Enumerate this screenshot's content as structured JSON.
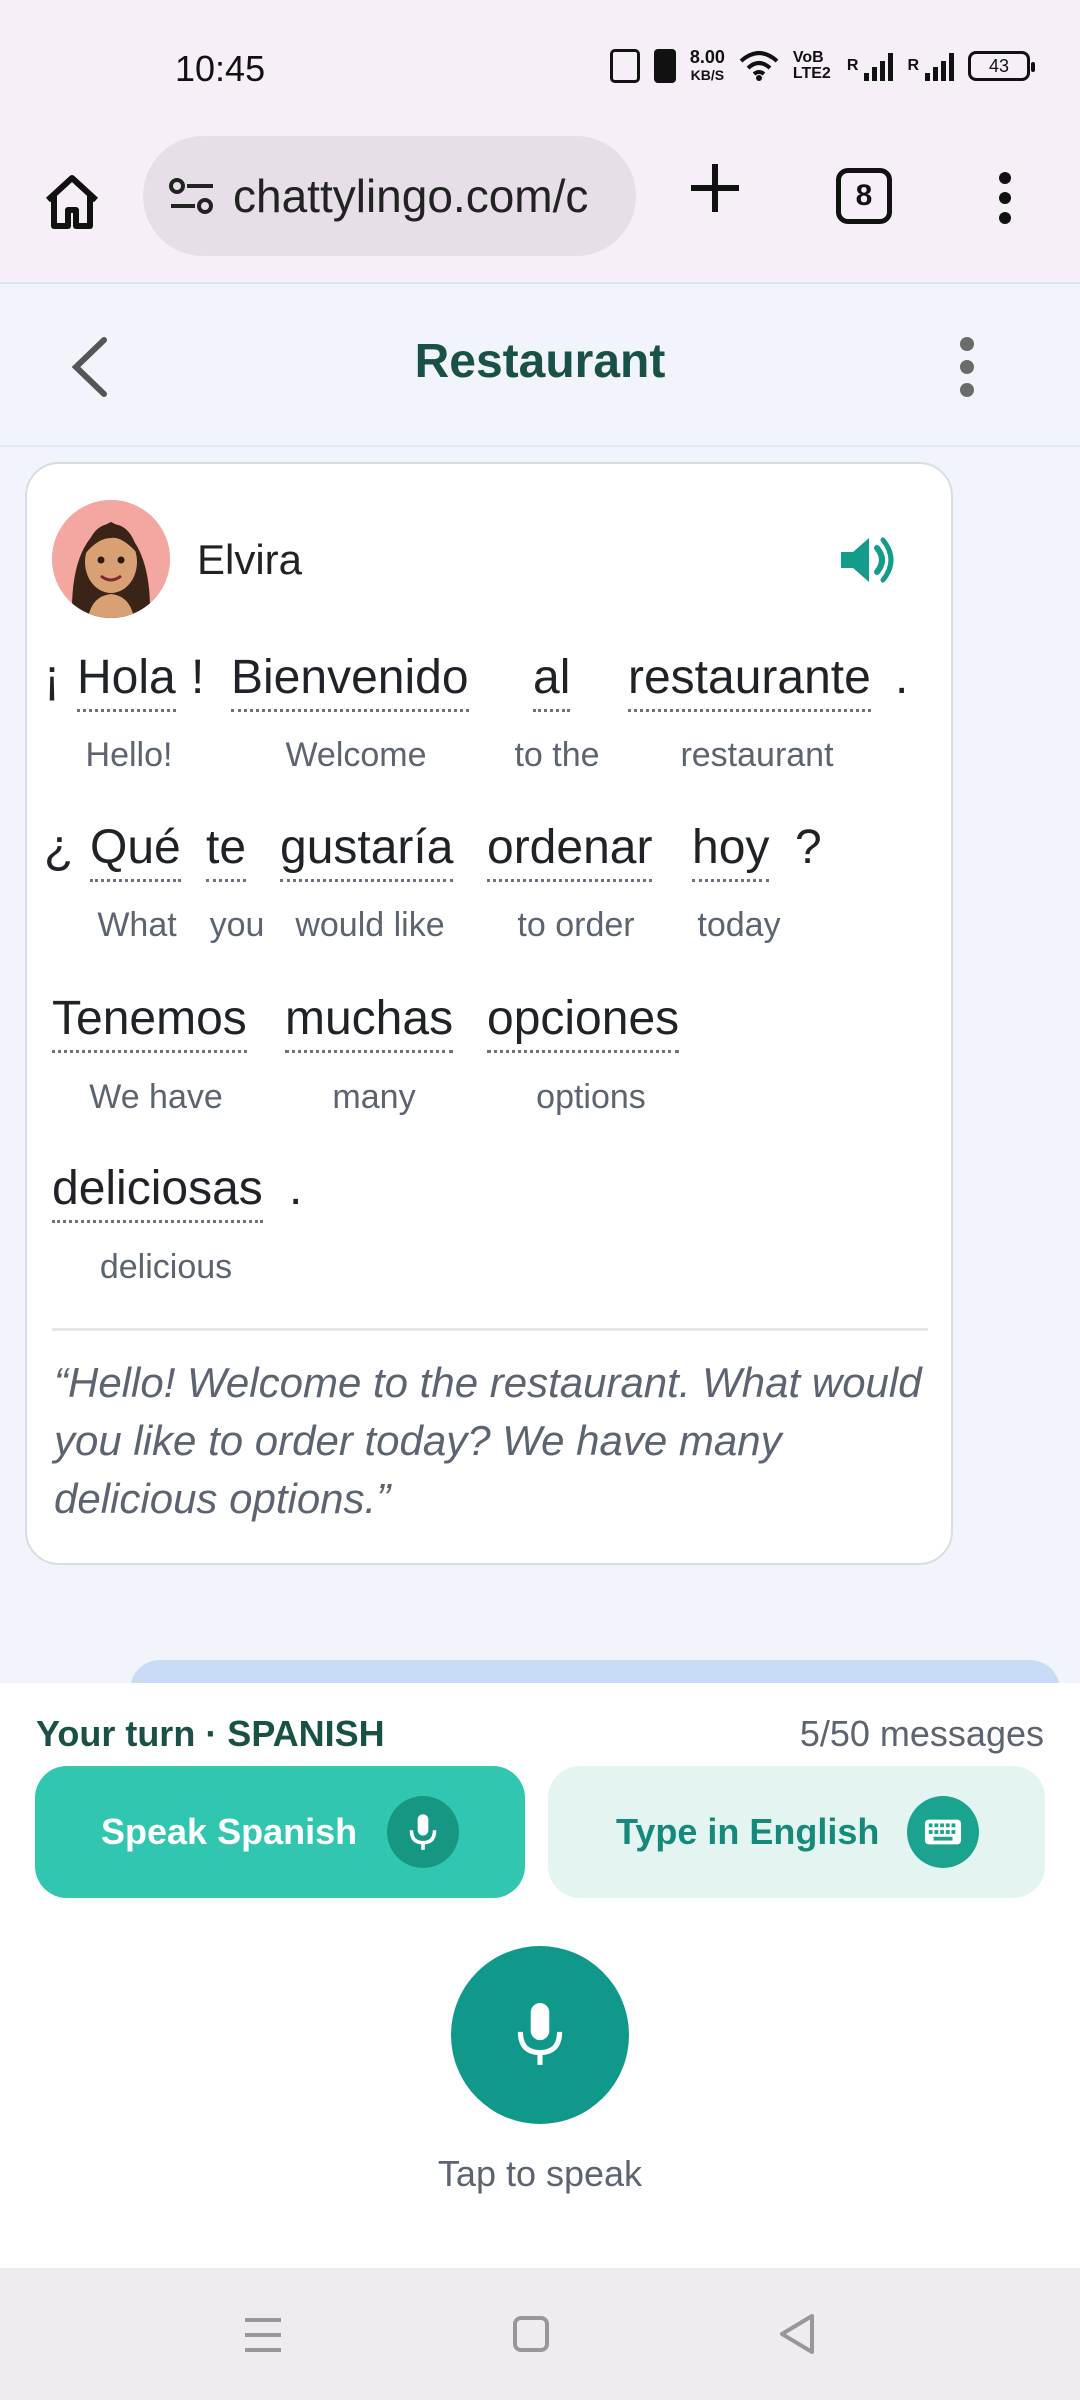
{
  "status_bar": {
    "time": "10:45",
    "speed_value": "8.00",
    "speed_unit": "KB/S",
    "volte": "VoB LTE2",
    "battery": "43",
    "icons": [
      "nfc-icon",
      "vibrate-icon",
      "wifi-icon",
      "signal-icon",
      "battery-icon"
    ]
  },
  "browser": {
    "url": "chattylingo.com/c",
    "tab_count": "8",
    "icons": [
      "home-icon",
      "site-settings-icon",
      "new-tab-icon",
      "overflow-menu-icon"
    ]
  },
  "header": {
    "title": "Restaurant",
    "icons": [
      "back-icon",
      "more-vert-icon"
    ]
  },
  "message": {
    "speaker": "Elvira",
    "lines": [
      [
        {
          "text": "¡",
          "gloss": ""
        },
        {
          "text": "Hola",
          "gloss": "Hello!"
        },
        {
          "text": "!",
          "gloss": ""
        },
        {
          "text": "Bienvenido",
          "gloss": "Welcome"
        },
        {
          "text": "al",
          "gloss": "to the"
        },
        {
          "text": "restaurante",
          "gloss": "restaurant"
        },
        {
          "text": ".",
          "gloss": ""
        }
      ],
      [
        {
          "text": "¿",
          "gloss": ""
        },
        {
          "text": "Qué",
          "gloss": "What"
        },
        {
          "text": "te",
          "gloss": "you"
        },
        {
          "text": "gustaría",
          "gloss": "would like"
        },
        {
          "text": "ordenar",
          "gloss": "to order"
        },
        {
          "text": "hoy",
          "gloss": "today"
        },
        {
          "text": "?",
          "gloss": ""
        }
      ],
      [
        {
          "text": "Tenemos",
          "gloss": "We have"
        },
        {
          "text": "muchas",
          "gloss": "many"
        },
        {
          "text": "opciones",
          "gloss": "options"
        }
      ],
      [
        {
          "text": "deliciosas",
          "gloss": "delicious"
        },
        {
          "text": ".",
          "gloss": ""
        }
      ]
    ],
    "translation": "“Hello! Welcome to the restaurant. What would you like to order today? We have many delicious options.”"
  },
  "composer": {
    "turn_label": "Your turn · SPANISH",
    "message_count": "5/50 messages",
    "speak_label": "Speak Spanish",
    "type_label": "Type in English",
    "tap_label": "Tap to speak"
  },
  "colors": {
    "brand_dark": "#1a5146",
    "accent": "#31c6b0",
    "accent_dark": "#10998a",
    "accent_light": "#e3f4f1"
  },
  "nav": {
    "icons": [
      "recents-icon",
      "home-nav-icon",
      "back-nav-icon"
    ]
  }
}
